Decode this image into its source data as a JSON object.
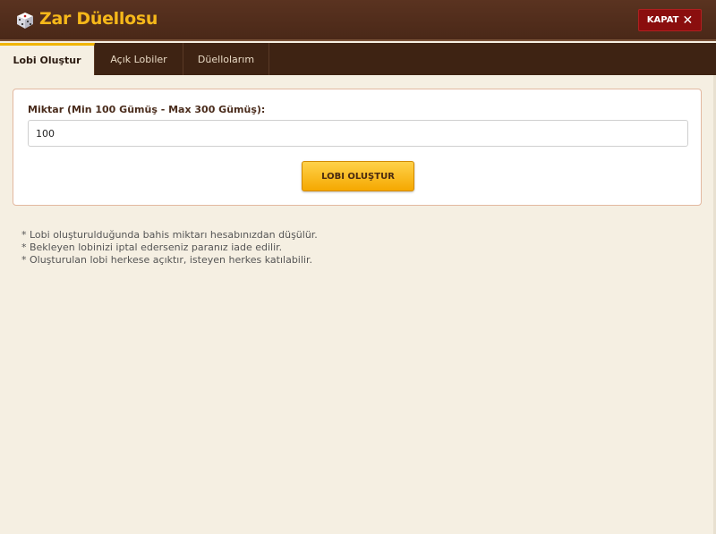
{
  "header": {
    "title": "Zar Düellosu",
    "close_label": "KAPAT",
    "icons": {
      "dice": "dice-icon",
      "close": "close-icon"
    },
    "colors": {
      "title": "#f6b81a",
      "close_bg": "#8a0e0e",
      "header_bg": "#4a2818"
    }
  },
  "tabs": [
    {
      "label": "Lobi Oluştur",
      "active": true
    },
    {
      "label": "Açık Lobiler",
      "active": false
    },
    {
      "label": "Düellolarım",
      "active": false
    }
  ],
  "form": {
    "amount_label": "Miktar (Min 100 Gümüş - Max 300 Gümüş):",
    "amount_value": "100",
    "submit_label": "LOBI OLUŞTUR",
    "colors": {
      "submit_bg": "#f5a800"
    }
  },
  "notes": [
    "* Lobi oluşturulduğunda bahis miktarı hesabınızdan düşülür.",
    "* Bekleyen lobinizi iptal ederseniz paranız iade edilir.",
    "* Oluşturulan lobi herkese açıktır, isteyen herkes katılabilir."
  ]
}
